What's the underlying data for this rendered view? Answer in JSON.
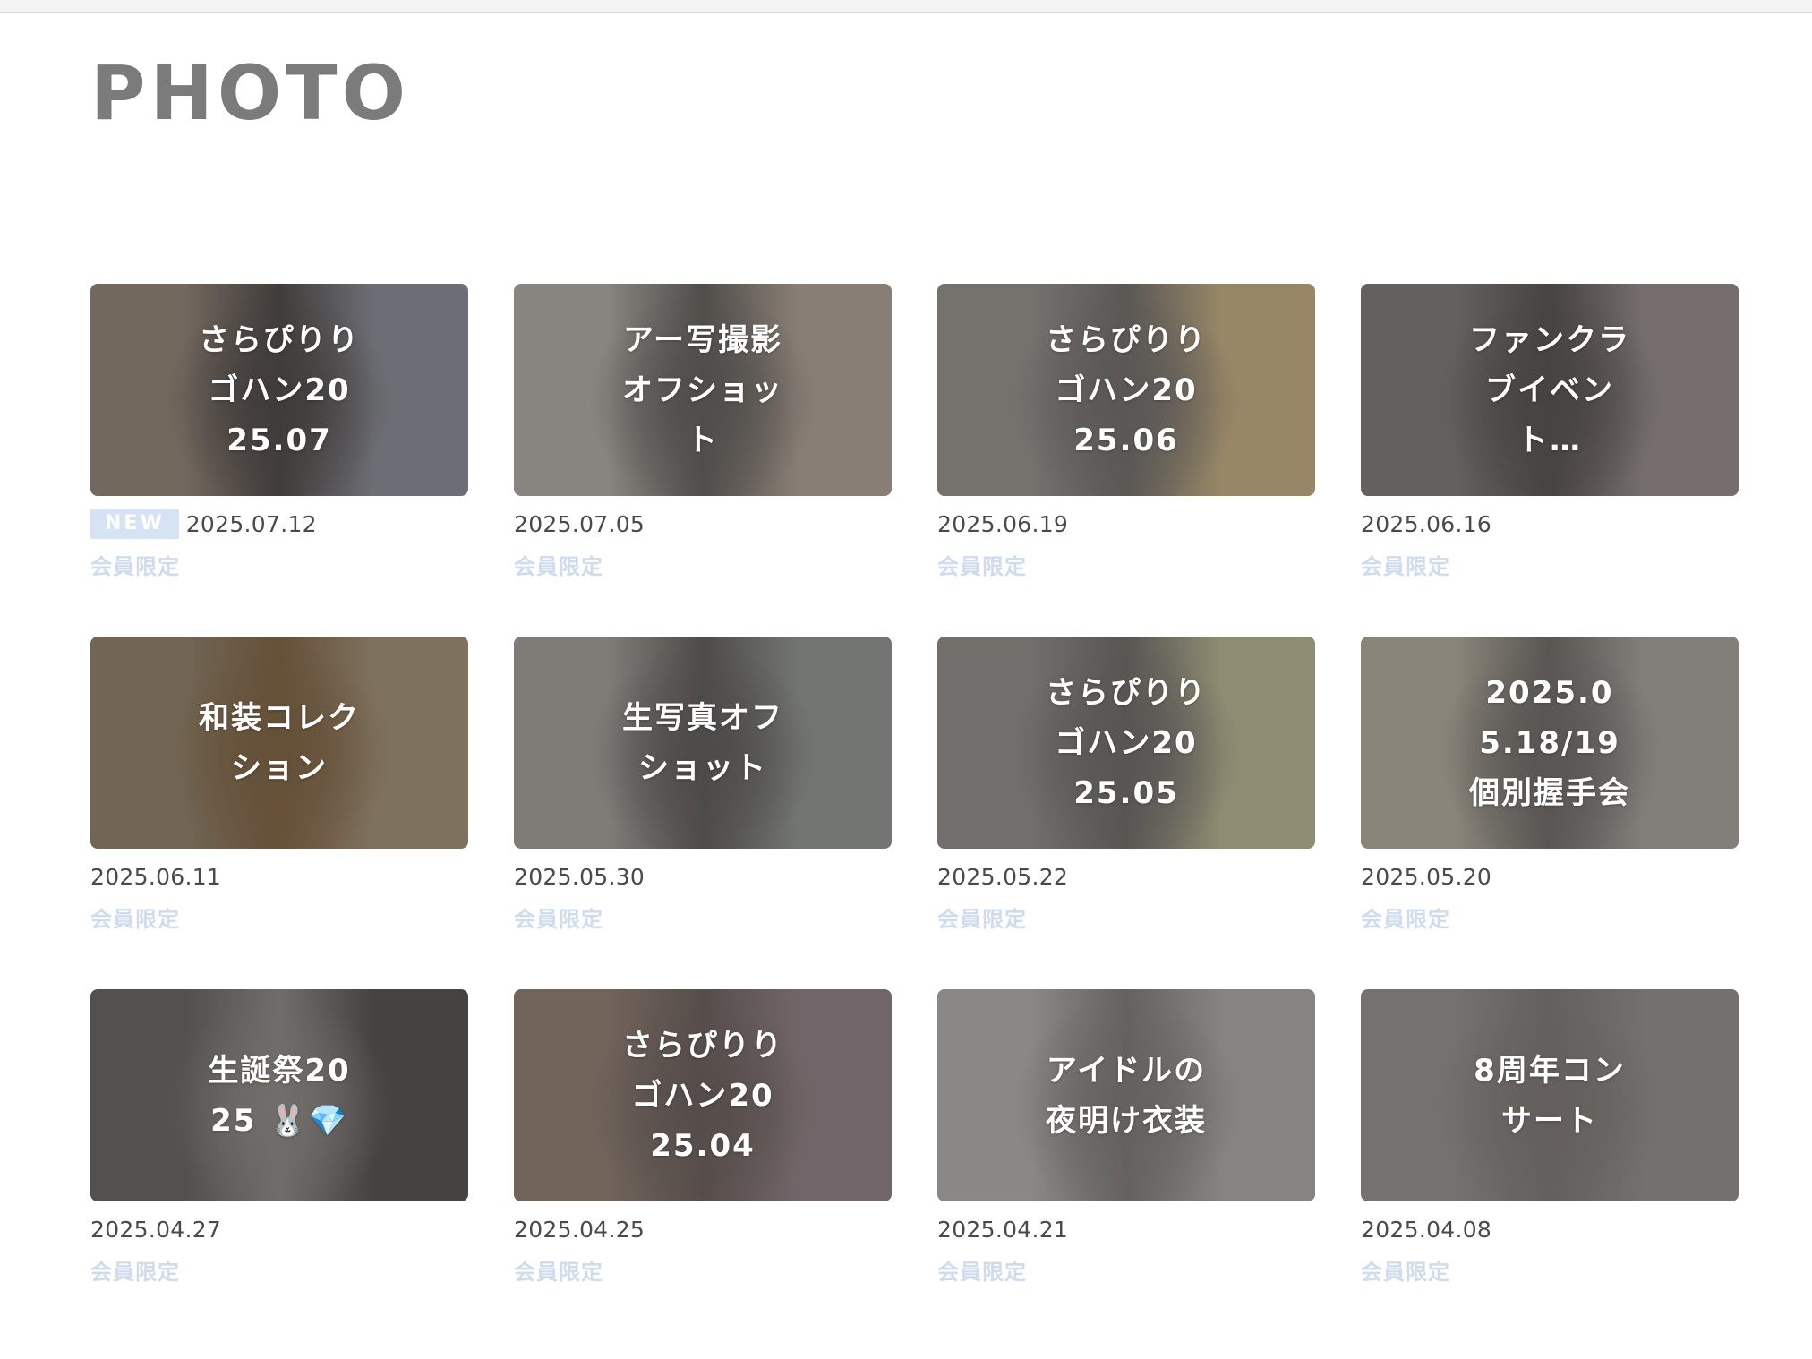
{
  "page": {
    "title": "PHOTO"
  },
  "badge_label": "NEW",
  "items": [
    {
      "title": "さらぴりりゴハン2025.07",
      "date": "2025.07.12",
      "tag": "会員限定",
      "is_new": true,
      "thumb_colors": [
        "#8c7f73",
        "#4f4a48",
        "#86878f"
      ]
    },
    {
      "title": "アー写撮影オフショット",
      "date": "2025.07.05",
      "tag": "会員限定",
      "is_new": false,
      "thumb_colors": [
        "#a6a29c",
        "#625f5c",
        "#a89a8f"
      ]
    },
    {
      "title": "さらぴりりゴハン2025.06",
      "date": "2025.06.19",
      "tag": "会員限定",
      "is_new": false,
      "thumb_colors": [
        "#8f8a86",
        "#6e6b68",
        "#b9a57e"
      ]
    },
    {
      "title": "ファンクラブイベント…",
      "date": "2025.06.16",
      "tag": "会員限定",
      "is_new": false,
      "thumb_colors": [
        "#7b7674",
        "#57524f",
        "#8f8786"
      ]
    },
    {
      "title": "和装コレクション",
      "date": "2025.06.11",
      "tag": "会員限定",
      "is_new": false,
      "thumb_colors": [
        "#8a7c67",
        "#7c6245",
        "#9a8b74"
      ]
    },
    {
      "title": "生写真オフショット",
      "date": "2025.05.30",
      "tag": "会員限定",
      "is_new": false,
      "thumb_colors": [
        "#9c9792",
        "#5f5c5b",
        "#8c8f8c"
      ]
    },
    {
      "title": "さらぴりりゴハン2025.05",
      "date": "2025.05.22",
      "tag": "会員限定",
      "is_new": false,
      "thumb_colors": [
        "#8a8784",
        "#6c6966",
        "#aeab8c"
      ]
    },
    {
      "title": "2025.05.18/19 個別握手会",
      "date": "2025.05.20",
      "tag": "会員限定",
      "is_new": false,
      "thumb_colors": [
        "#a8a395",
        "#6d6966",
        "#9d9c95"
      ]
    },
    {
      "title": "生誕祭2025 🐰💎",
      "date": "2025.04.27",
      "tag": "会員限定",
      "is_new": false,
      "thumb_colors": [
        "#66625f",
        "#8a8582",
        "#555250"
      ]
    },
    {
      "title": "さらぴりりゴハン2025.04",
      "date": "2025.04.25",
      "tag": "会員限定",
      "is_new": false,
      "thumb_colors": [
        "#8a7a70",
        "#6a5f5c",
        "#8b7c80"
      ]
    },
    {
      "title": "アイドルの夜明け衣装",
      "date": "2025.04.21",
      "tag": "会員限定",
      "is_new": false,
      "thumb_colors": [
        "#a8a6a4",
        "#7b7876",
        "#a3a19f"
      ]
    },
    {
      "title": "8周年コンサート",
      "date": "2025.04.08",
      "tag": "会員限定",
      "is_new": false,
      "thumb_colors": [
        "#8e8a87",
        "#7a7572",
        "#8d8986"
      ]
    }
  ]
}
